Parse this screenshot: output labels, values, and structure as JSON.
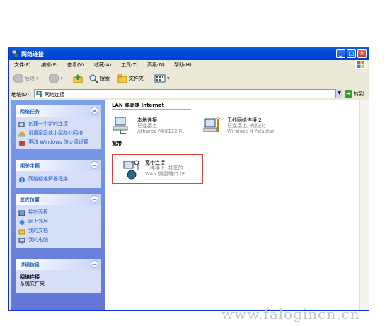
{
  "window": {
    "title": "网络连接",
    "controls": {
      "minimize": "_",
      "maximize": "□",
      "close": "×"
    }
  },
  "menubar": {
    "items": [
      {
        "label": "文件(F)"
      },
      {
        "label": "编辑(E)"
      },
      {
        "label": "查看(V)"
      },
      {
        "label": "收藏(A)"
      },
      {
        "label": "工具(T)"
      },
      {
        "label": "高级(N)"
      },
      {
        "label": "帮助(H)"
      }
    ]
  },
  "toolbar": {
    "back_label": "后退",
    "search_label": "搜索",
    "folders_label": "文件夹"
  },
  "address": {
    "label": "地址(D)",
    "value": "网络连接",
    "go_label": "转到"
  },
  "sidebar": {
    "panels": [
      {
        "title": "网络任务",
        "items": [
          {
            "label": "创建一个新的连接",
            "icon": "new-connection-icon"
          },
          {
            "label": "设置家庭或小型办公网络",
            "icon": "home-network-icon"
          },
          {
            "label": "更改 Windows 防火墙设置",
            "icon": "firewall-icon"
          }
        ]
      },
      {
        "title": "相关主题",
        "items": [
          {
            "label": "网络疑难解答程序",
            "icon": "info-icon"
          }
        ]
      },
      {
        "title": "其它位置",
        "items": [
          {
            "label": "控制面板",
            "icon": "control-panel-icon"
          },
          {
            "label": "网上邻居",
            "icon": "network-places-icon"
          },
          {
            "label": "我的文档",
            "icon": "my-documents-icon"
          },
          {
            "label": "我的电脑",
            "icon": "my-computer-icon"
          }
        ]
      },
      {
        "title": "详细信息",
        "detail_title": "网络连接",
        "detail_sub": "系统文件夹"
      }
    ]
  },
  "content": {
    "groups": [
      {
        "title": "LAN 或高速 Internet",
        "connections": [
          {
            "name": "本地连接",
            "status": "已连接上",
            "device": "Atheros AR8132 P..."
          },
          {
            "name": "无线网络连接 2",
            "status": "已连接上, 有防火...",
            "device": "Wireless N Adapter"
          }
        ]
      },
      {
        "title": "宽带",
        "connections": [
          {
            "name": "宽带连接",
            "status": "已连接上, 共享的",
            "device": "WAN 微型端口 (P..."
          }
        ]
      }
    ]
  },
  "watermark": "www.falogincn.cn",
  "colors": {
    "title_bar": "#0055E5",
    "sidebar_bg": "#7BA2E7",
    "highlight": "#E04040"
  }
}
